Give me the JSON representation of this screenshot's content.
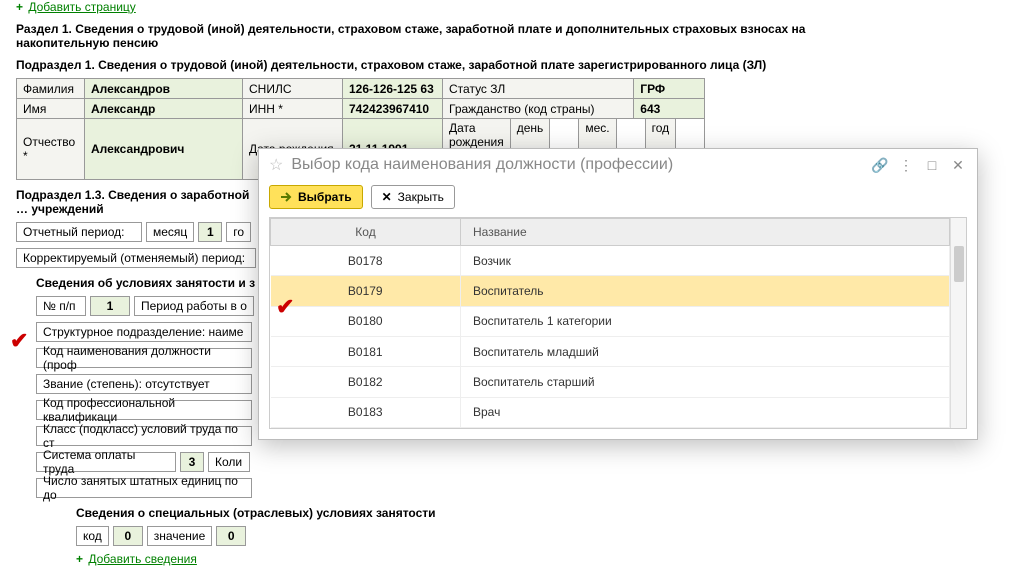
{
  "links": {
    "add_page": "Добавить страницу",
    "add_info": "Добавить сведения"
  },
  "section1_title": "Раздел 1. Сведения о трудовой (иной) деятельности, страховом стаже, заработной плате и дополнительных страховых взносах на накопительную пенсию",
  "sub1_title": "Подраздел 1. Сведения о трудовой (иной) деятельности, страховом стаже, заработной плате зарегистрированного лица (ЗЛ)",
  "person": {
    "lastname_lbl": "Фамилия",
    "lastname": "Александров",
    "firstname_lbl": "Имя",
    "firstname": "Александр",
    "patronymic_lbl": "Отчество *",
    "patronymic": "Александрович",
    "snils_lbl": "СНИЛС",
    "snils": "126-126-125 63",
    "inn_lbl": "ИНН *",
    "inn": "742423967410",
    "dob_lbl": "Дата рождения",
    "dob": "21.11.1991",
    "status_lbl": "Статус ЗЛ",
    "grf_lbl": "ГРФ",
    "citizenship_lbl": "Гражданство (код страны)",
    "citizenship": "643",
    "special_dob_lbl": "Дата рождения \"особая\" **:",
    "day_lbl": "день",
    "month_lbl": "мес.",
    "year_lbl": "год"
  },
  "sub13_title": "Подраздел 1.3.  Сведения о заработной … учреждений",
  "period": {
    "report_period_lbl": "Отчетный период:",
    "month_lbl": "месяц",
    "month_val": "1",
    "year_lbl": "го",
    "corrected_lbl": "Корректируемый (отменяемый) период:"
  },
  "employment": {
    "heading": "Сведения об условиях занятости и з",
    "npp_lbl": "№ п/п",
    "npp": "1",
    "period_work_lbl": "Период работы в о",
    "struct_lbl": "Структурное подразделение:   наиме",
    "jobcode_lbl": "Код наименования должности (проф",
    "rank_lbl": "Звание (степень):   отсутствует",
    "profcode_lbl": "Код профессиональной квалификаци",
    "class_lbl": "Класс (подкласс) условий труда по ст",
    "paysystem_lbl": "Система оплаты труда",
    "paysystem_val": "3",
    "qty_lbl": "Коли",
    "units_lbl": "Число занятых штатных единиц по до"
  },
  "special": {
    "heading": "Сведения о специальных (отраслевых) условиях занятости",
    "code_lbl": "код",
    "code_val": "0",
    "value_lbl": "значение",
    "value_val": "0"
  },
  "dialog": {
    "title": "Выбор кода наименования должности (профессии)",
    "select_btn": "Выбрать",
    "close_btn": "Закрыть",
    "col_code": "Код",
    "col_name": "Название",
    "rows": [
      {
        "code": "В0178",
        "name": "Возчик"
      },
      {
        "code": "В0179",
        "name": "Воспитатель"
      },
      {
        "code": "В0180",
        "name": "Воспитатель 1 категории"
      },
      {
        "code": "В0181",
        "name": "Воспитатель младший"
      },
      {
        "code": "В0182",
        "name": "Воспитатель старший"
      },
      {
        "code": "В0183",
        "name": "Врач"
      }
    ],
    "selected_index": 1
  }
}
